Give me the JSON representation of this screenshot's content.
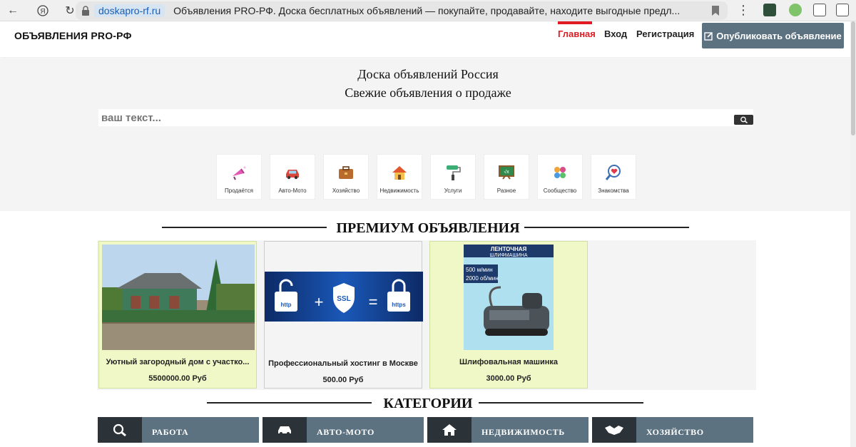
{
  "browser": {
    "domain": "doskapro-rf.ru",
    "page_title": "Объявления PRO-РФ. Доска бесплатных объявлений — покупайте, продавайте, находите выгодные предл..."
  },
  "header": {
    "logo": "ОБЪЯВЛЕНИЯ PRO-РФ",
    "menu": [
      "Главная",
      "Вход",
      "Регистрация"
    ],
    "publish_label": "Опубликовать объявление"
  },
  "hero": {
    "line1": "Доска объявлений Россия",
    "line2": "Свежие объявления о продаже",
    "search_placeholder": "ваш текст..."
  },
  "categories_tiles": [
    {
      "label": "Продаётся",
      "icon": "megaphone-icon"
    },
    {
      "label": "Авто-Мото",
      "icon": "car-icon"
    },
    {
      "label": "Хозяйство",
      "icon": "briefcase-icon"
    },
    {
      "label": "Недвижимость",
      "icon": "house-icon"
    },
    {
      "label": "Услуги",
      "icon": "paint-roller-icon"
    },
    {
      "label": "Разное",
      "icon": "chalkboard-icon"
    },
    {
      "label": "Сообщество",
      "icon": "people-icon"
    },
    {
      "label": "Знакомства",
      "icon": "heart-search-icon"
    }
  ],
  "premium": {
    "title": "ПРЕМИУМ ОБЪЯВЛЕНИЯ",
    "cards": [
      {
        "title": "Уютный загородный дом с участко...",
        "price": "5500000.00 Руб",
        "image": "house-photo"
      },
      {
        "title": "Профессиональный хостинг в Москве",
        "price": "500.00 Руб",
        "image": "ssl-banner"
      },
      {
        "title": "Шлифовальная машинка",
        "price": "3000.00 Руб",
        "image": "sander-photo"
      }
    ],
    "ssl_text": {
      "http": "http",
      "ssl": "SSL",
      "https": "https"
    },
    "sander_text": {
      "top": "ЛЕНТОЧНАЯ",
      "sub": "ШЛИФМАШИНА",
      "spec1": "500 м/мин",
      "spec2": "2000 об/мин"
    }
  },
  "categories": {
    "title": "КАТЕГОРИИ",
    "bars": [
      {
        "label": "РАБОТА",
        "icon": "magnifier-icon"
      },
      {
        "label": "АВТО-МОТО",
        "icon": "car-icon"
      },
      {
        "label": "НЕДВИЖИМОСТЬ",
        "icon": "home-icon"
      },
      {
        "label": "ХОЗЯЙСТВО",
        "icon": "handshake-icon"
      }
    ]
  },
  "colors": {
    "accent": "#e21b23",
    "button": "#5c7281",
    "highlight": "#f1f8c8"
  }
}
